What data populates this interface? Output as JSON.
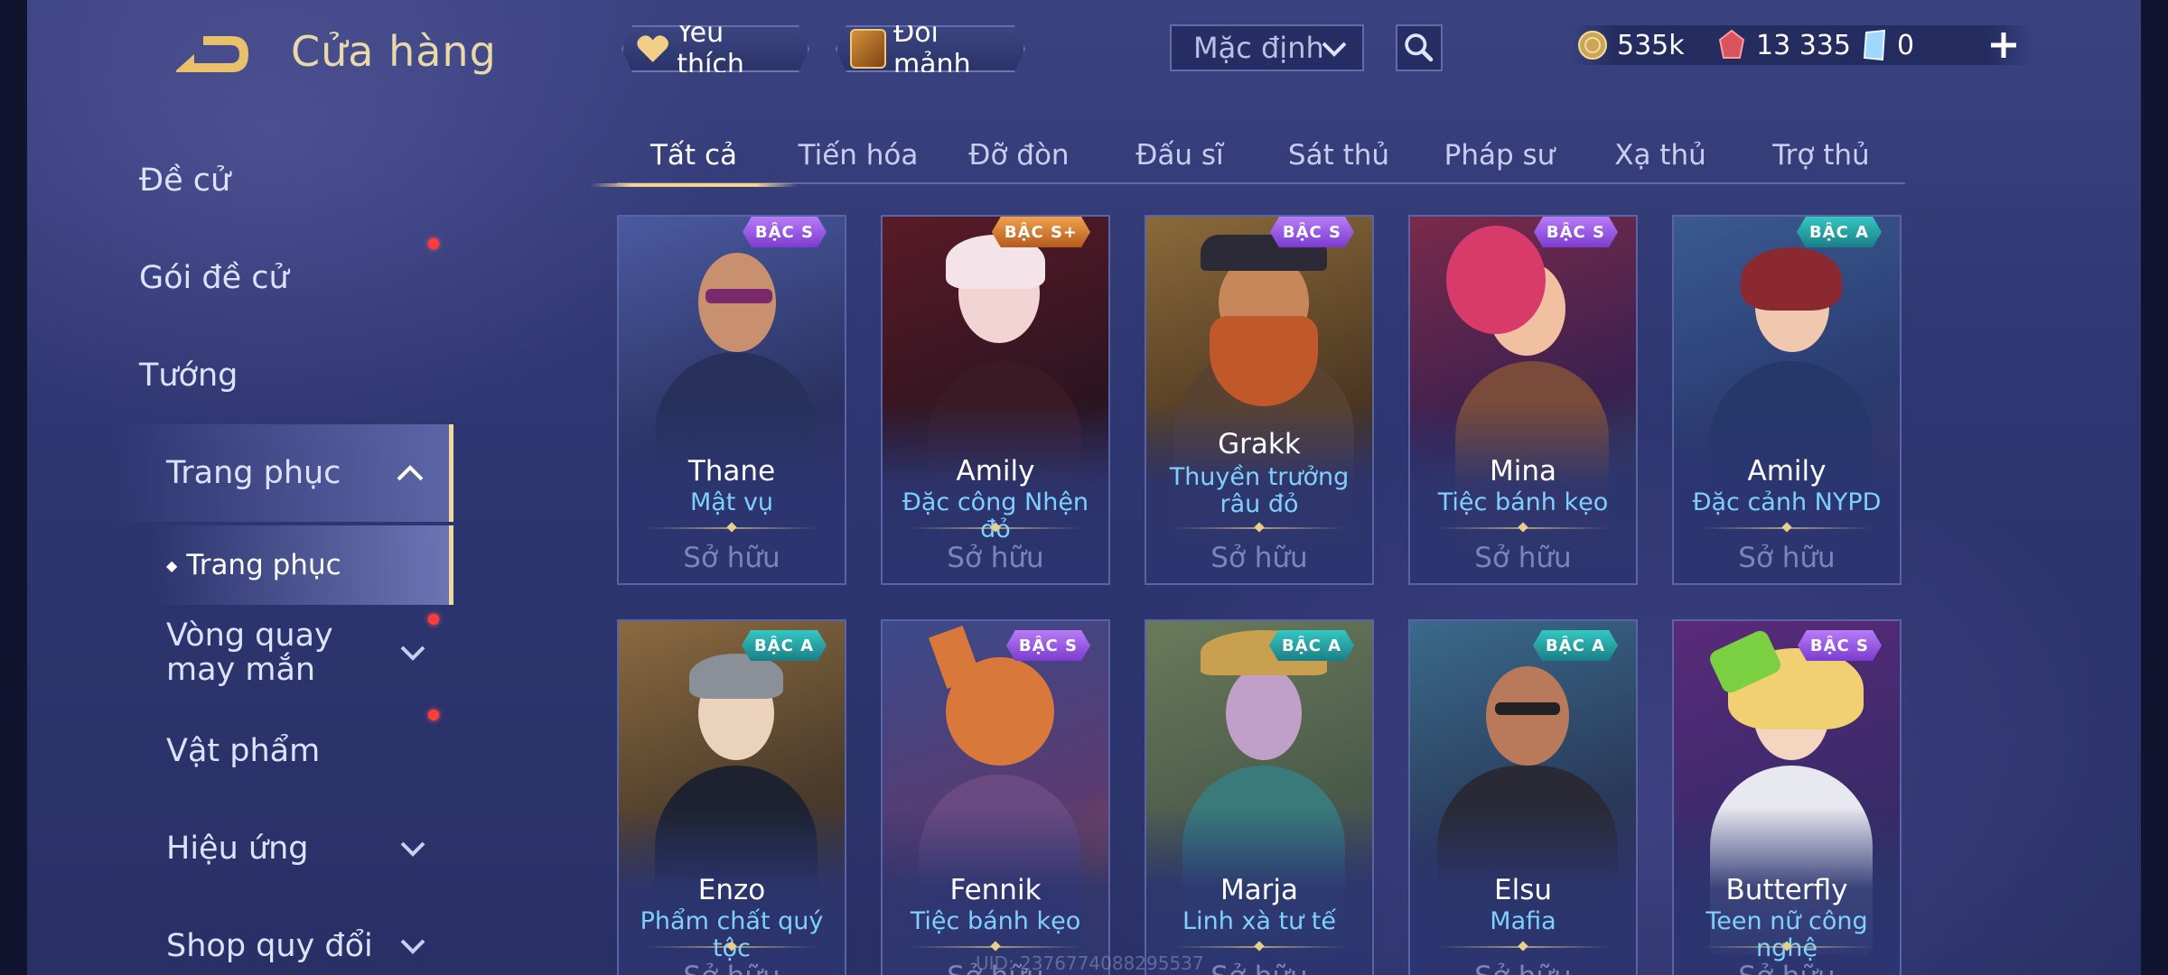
{
  "header": {
    "title": "Cửa hàng",
    "favorites_label": "Yêu thích",
    "shards_label": "Đổi mảnh",
    "sort_value": "Mặc định"
  },
  "currencies": {
    "gold": "535k",
    "vouchers": "13 335",
    "tickets": "0"
  },
  "sidebar": {
    "items": [
      {
        "label": "Đề cử"
      },
      {
        "label": "Gói đề cử"
      },
      {
        "label": "Tướng"
      },
      {
        "label": "Trang phục"
      },
      {
        "label": "Vòng quay may mắn"
      },
      {
        "label": "Vật phẩm"
      },
      {
        "label": "Hiệu ứng"
      },
      {
        "label": "Shop quy đổi"
      }
    ],
    "sub_item": "Trang phục"
  },
  "tabs": [
    "Tất cả",
    "Tiến hóa",
    "Đỡ đòn",
    "Đấu sĩ",
    "Sát thủ",
    "Pháp sư",
    "Xạ thủ",
    "Trợ thủ"
  ],
  "cards": [
    {
      "hero": "Thane",
      "skin": "Mật vụ",
      "tier": "BẬC S",
      "status": "Sở hữu"
    },
    {
      "hero": "Amily",
      "skin": "Đặc công Nhện đỏ",
      "tier": "BẬC S+",
      "status": "Sở hữu"
    },
    {
      "hero": "Grakk",
      "skin": "Thuyền trưởng râu đỏ",
      "tier": "BẬC S",
      "status": "Sở hữu"
    },
    {
      "hero": "Mina",
      "skin": "Tiệc bánh kẹo",
      "tier": "BẬC S",
      "status": "Sở hữu"
    },
    {
      "hero": "Amily",
      "skin": "Đặc cảnh NYPD",
      "tier": "BẬC A",
      "status": "Sở hữu"
    },
    {
      "hero": "Enzo",
      "skin": "Phẩm chất quý tộc",
      "tier": "BẬC A",
      "status": "Sở hữu"
    },
    {
      "hero": "Fennik",
      "skin": "Tiệc bánh kẹo",
      "tier": "BẬC S",
      "status": "Sở hữu"
    },
    {
      "hero": "Marja",
      "skin": "Linh xà tư tế",
      "tier": "BẬC A",
      "status": "Sở hữu"
    },
    {
      "hero": "Elsu",
      "skin": "Mafia",
      "tier": "BẬC A",
      "status": "Sở hữu"
    },
    {
      "hero": "Butterfly",
      "skin": "Teen nữ công nghệ",
      "tier": "BẬC S",
      "status": "Sở hữu"
    }
  ],
  "uid_text": "UID: 2376774088295537",
  "colors": {
    "accent_gold": "#f4d58c",
    "skin_name": "#7fd0ff",
    "notification": "#ff3b3b"
  }
}
